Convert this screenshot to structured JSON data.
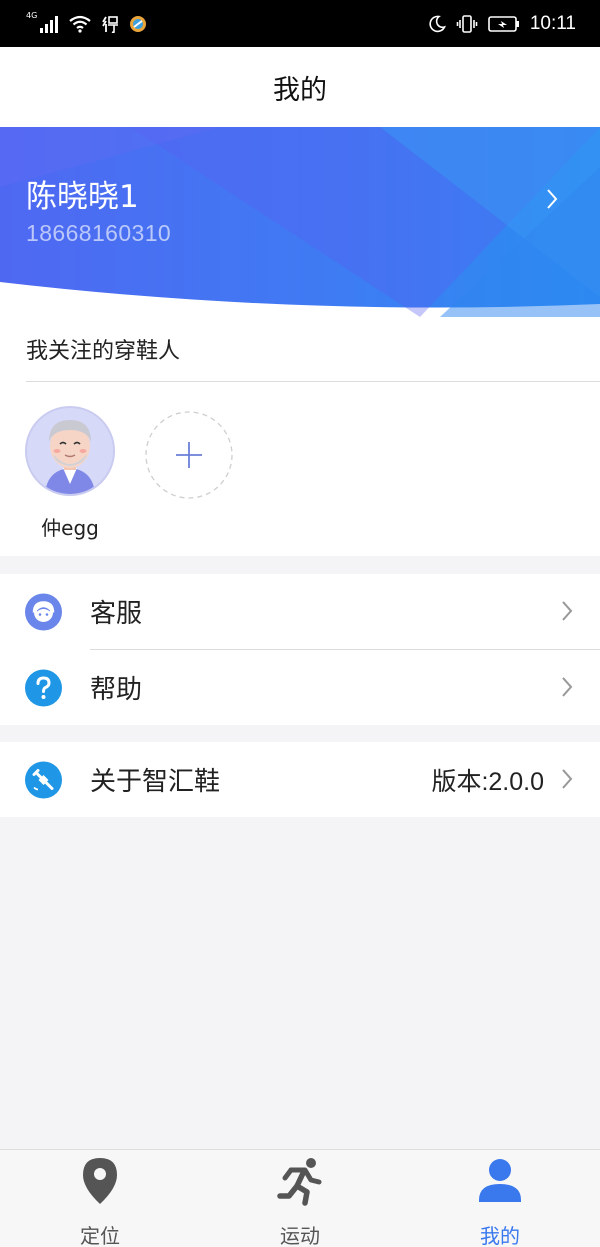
{
  "status_bar": {
    "network": "4G",
    "time": "10:11"
  },
  "header": {
    "title": "我的"
  },
  "profile": {
    "name": "陈晓晓1",
    "phone": "18668160310"
  },
  "followed": {
    "title": "我关注的穿鞋人",
    "people": [
      {
        "name": "仲egg"
      }
    ]
  },
  "menu": {
    "customer_service": {
      "label": "客服",
      "icon": "headset-icon"
    },
    "help": {
      "label": "帮助",
      "icon": "question-icon"
    },
    "about": {
      "label": "关于智汇鞋",
      "value": "版本:2.0.0",
      "icon": "satellite-icon"
    }
  },
  "tabs": [
    {
      "label": "定位",
      "icon": "location-pin-icon",
      "active": false
    },
    {
      "label": "运动",
      "icon": "running-icon",
      "active": false
    },
    {
      "label": "我的",
      "icon": "user-icon",
      "active": true
    }
  ],
  "colors": {
    "accent": "#3a78ee",
    "banner_start": "#4a6cf0",
    "banner_end": "#2d8cf0"
  }
}
